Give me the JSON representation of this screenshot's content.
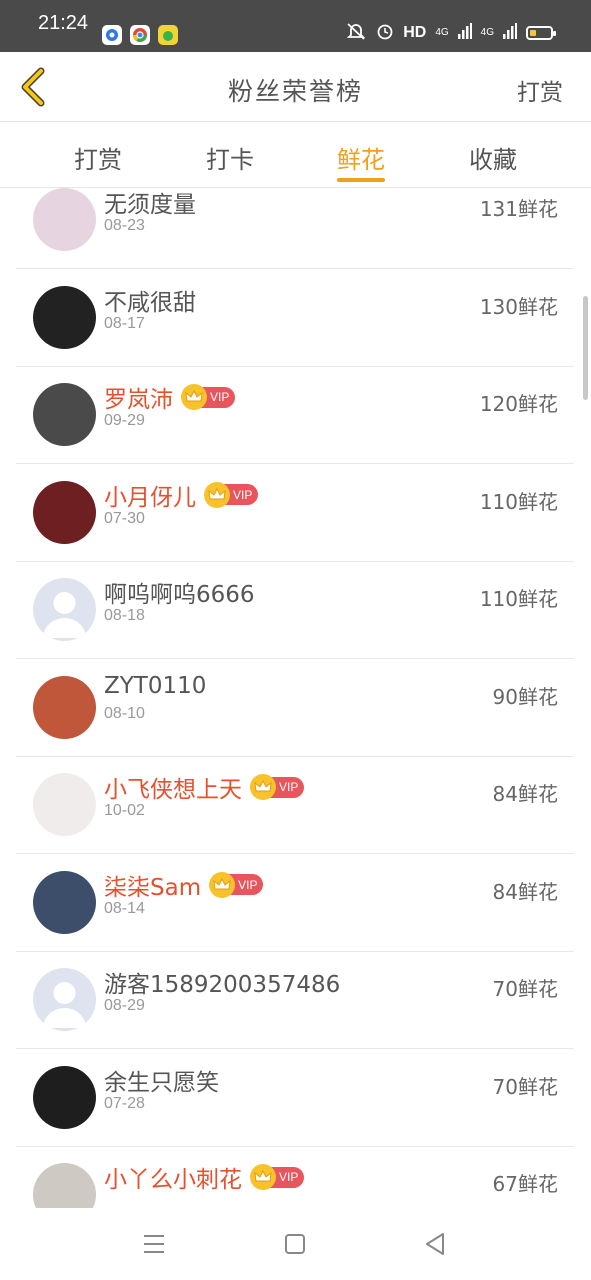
{
  "status_bar": {
    "time": "21:24",
    "hd_label": "HD",
    "network_1": "4G",
    "network_2": "4G",
    "app_icons": [
      "location-app-icon",
      "chrome-app-icon",
      "green-app-icon"
    ]
  },
  "header": {
    "title": "粉丝荣誉榜",
    "right_action": "打赏"
  },
  "tabs": [
    {
      "label": "打赏",
      "active": false
    },
    {
      "label": "打卡",
      "active": false
    },
    {
      "label": "鲜花",
      "active": true
    },
    {
      "label": "收藏",
      "active": false
    }
  ],
  "vip_label": "VIP",
  "fans": [
    {
      "name": "无须度量",
      "date": "08-23",
      "flowers": "131鲜花",
      "vip": false,
      "avatar_color": "#e6d5e1"
    },
    {
      "name": "不咸很甜",
      "date": "08-17",
      "flowers": "130鲜花",
      "vip": false,
      "avatar_color": "#222222"
    },
    {
      "name": "罗岚沛",
      "date": "09-29",
      "flowers": "120鲜花",
      "vip": true,
      "avatar_color": "#4a4a4a"
    },
    {
      "name": "小月伢儿",
      "date": "07-30",
      "flowers": "110鲜花",
      "vip": true,
      "avatar_color": "#6e1f22"
    },
    {
      "name": "啊呜啊呜6666",
      "date": "08-18",
      "flowers": "110鲜花",
      "vip": false,
      "avatar_color": "#dfe3ef"
    },
    {
      "name": "ZYT0110",
      "date": "08-10",
      "flowers": "90鲜花",
      "vip": false,
      "avatar_color": "#c0563a"
    },
    {
      "name": "小飞侠想上天",
      "date": "10-02",
      "flowers": "84鲜花",
      "vip": true,
      "avatar_color": "#f1ecec"
    },
    {
      "name": "柒柒Sam",
      "date": "08-14",
      "flowers": "84鲜花",
      "vip": true,
      "avatar_color": "#3d4e6a"
    },
    {
      "name": "游客1589200357486",
      "date": "08-29",
      "flowers": "70鲜花",
      "vip": false,
      "avatar_color": "#dfe3ef"
    },
    {
      "name": "余生只愿笑",
      "date": "07-28",
      "flowers": "70鲜花",
      "vip": false,
      "avatar_color": "#1e1e1e"
    },
    {
      "name": "小丫么小刺花",
      "date": "",
      "flowers": "67鲜花",
      "vip": true,
      "avatar_color": "#cfc9c4"
    }
  ],
  "colors": {
    "accent": "#f0a11b",
    "vip_name": "#e8502d",
    "vip_badge": "#e8555d",
    "crown": "#f7c22a"
  }
}
